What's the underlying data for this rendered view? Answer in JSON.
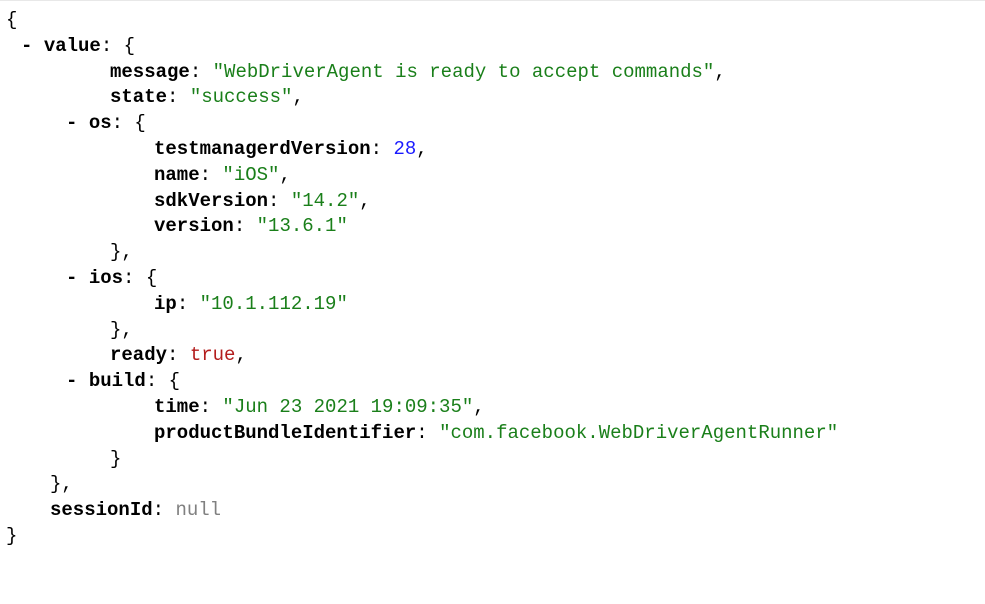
{
  "json": {
    "open_root": "{",
    "close_root": "}",
    "collapse_toggle": "-",
    "value_key": "value",
    "message_key": "message",
    "message_val": "\"WebDriverAgent is ready to accept commands\"",
    "state_key": "state",
    "state_val": "\"success\"",
    "os_key": "os",
    "testmanagerd_key": "testmanagerdVersion",
    "testmanagerd_val": "28",
    "name_key": "name",
    "name_val": "\"iOS\"",
    "sdk_key": "sdkVersion",
    "sdk_val": "\"14.2\"",
    "version_key": "version",
    "version_val": "\"13.6.1\"",
    "ios_key": "ios",
    "ip_key": "ip",
    "ip_val": "\"10.1.112.19\"",
    "ready_key": "ready",
    "ready_val": "true",
    "build_key": "build",
    "time_key": "time",
    "time_val": "\"Jun 23 2021 19:09:35\"",
    "bundle_key": "productBundleIdentifier",
    "bundle_val": "\"com.facebook.WebDriverAgentRunner\"",
    "session_key": "sessionId",
    "session_val": "null"
  },
  "colors": {
    "string": "#1a7f1a",
    "number": "#1a1aff",
    "boolean": "#b31d1d",
    "null": "#808080"
  }
}
